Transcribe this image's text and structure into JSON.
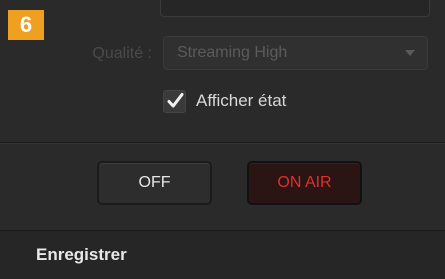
{
  "step": {
    "number": "6",
    "badge_color": "#f0a020"
  },
  "quality": {
    "label": "Qualité :",
    "value": "Streaming High",
    "icon": "chevron-down-icon"
  },
  "status": {
    "checked": true,
    "label": "Afficher état",
    "icon": "checkmark-icon"
  },
  "buttons": {
    "off_label": "OFF",
    "on_air_label": "ON AIR",
    "on_air_color": "#e0302a"
  },
  "section": {
    "title": "Enregistrer"
  }
}
